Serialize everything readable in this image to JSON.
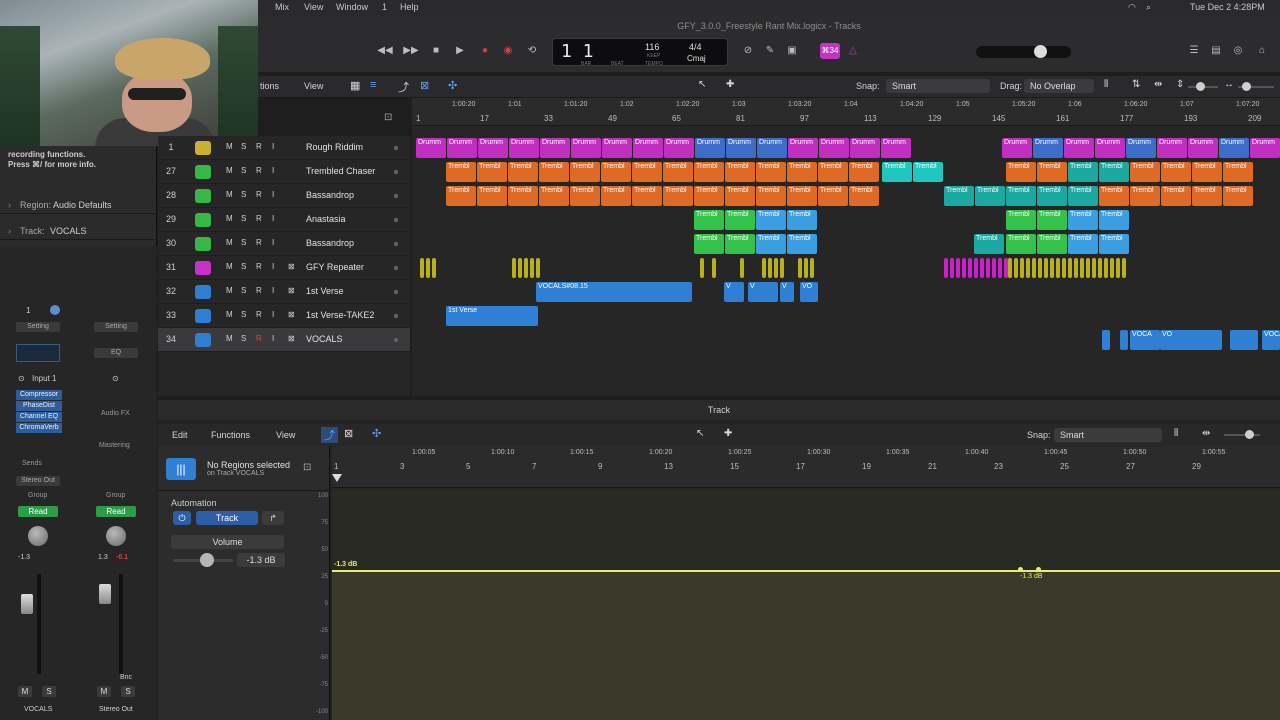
{
  "menubar": {
    "items": [
      "Mix",
      "View",
      "Window",
      "1",
      "Help"
    ],
    "datetime": "Tue Dec 2  4:28PM"
  },
  "window_title": "GFY_3.0.0_Freestyle Rant Mix.logicx - Tracks",
  "lcd": {
    "position": "1  1",
    "bpm": "116",
    "bpm_label": "KEEP",
    "signature": "4/4",
    "key": "Cmaj",
    "bar_label": "BAR",
    "beat_label": "BEAT",
    "tempo_label": "TEMPO"
  },
  "badge": "⌘34",
  "tracks_bar": {
    "functions": "tions",
    "view": "View",
    "snap_label": "Snap:",
    "snap_value": "Smart",
    "drag_label": "Drag:",
    "drag_value": "No Overlap"
  },
  "ruler": {
    "bars": [
      "1",
      "17",
      "33",
      "49",
      "65",
      "81",
      "97",
      "113",
      "129",
      "145",
      "161",
      "177",
      "193",
      "209"
    ],
    "times": [
      "1:00:20",
      "1:01",
      "1:01:20",
      "1:02",
      "1:02:20",
      "1:03",
      "1:03:20",
      "1:04",
      "1:04:20",
      "1:05",
      "1:05:20",
      "1:06",
      "1:06:20",
      "1:07",
      "1:07:20"
    ]
  },
  "tracks": [
    {
      "num": "1",
      "name": "Rough Riddim",
      "icon": "folder-icon",
      "color": "#c8b030"
    },
    {
      "num": "27",
      "name": "Trembled Chaser",
      "icon": "drummer-icon",
      "color": "#35b845"
    },
    {
      "num": "28",
      "name": "Bassandrop",
      "icon": "drummer-icon",
      "color": "#35b845"
    },
    {
      "num": "29",
      "name": "Anastasia",
      "icon": "drummer-icon",
      "color": "#35b845"
    },
    {
      "num": "30",
      "name": "Bassandrop",
      "icon": "drummer-icon",
      "color": "#35b845"
    },
    {
      "num": "31",
      "name": "GFY Repeater",
      "icon": "waveform-icon",
      "color": "#c930c9"
    },
    {
      "num": "32",
      "name": "1st Verse",
      "icon": "waveform-icon",
      "color": "#2f7fd4"
    },
    {
      "num": "33",
      "name": "1st Verse-TAKE2",
      "icon": "waveform-icon",
      "color": "#2f7fd4"
    },
    {
      "num": "34",
      "name": "VOCALS",
      "icon": "waveform-icon",
      "color": "#2f7fd4"
    }
  ],
  "track_buttons": [
    "M",
    "S",
    "R",
    "I"
  ],
  "regions": {
    "drummer": "Drumm",
    "trembl": "Trembl",
    "vocals": "VOCALS#08.15",
    "first_verse": "1st Verse",
    "v": "V",
    "vo": "VO",
    "voca": "VOCA"
  },
  "inspector": {
    "help_1": "recording functions.",
    "help_2": "Press ⌘/ for more info.",
    "region_label": "Region:",
    "region_value": "Audio Defaults",
    "track_label": "Track:",
    "track_value": "VOCALS",
    "setting": "Setting",
    "eq": "EQ",
    "input": "Input 1",
    "plugins": [
      "Compressor",
      "PhaseDist",
      "Channel EQ",
      "ChromaVerb"
    ],
    "audio_fx": "Audio FX",
    "mastering": "Mastering",
    "sends": "Sends",
    "stereo_out": "Stereo Out",
    "group": "Group",
    "read": "Read",
    "vol_left": "-1.3",
    "vol_right": "1.3",
    "vol_peak": "-6.1",
    "bnc": "Bnc",
    "channel_1_name": "VOCALS",
    "channel_2_name": "Stereo Out",
    "one": "1"
  },
  "track_panel": {
    "title": "Track",
    "edit": "Edit",
    "functions": "Functions",
    "view": "View",
    "snap_label": "Snap:",
    "snap_value": "Smart",
    "no_regions": "No Regions selected",
    "on_track": "on Track VOCALS",
    "automation": "Automation",
    "track_btn": "Track",
    "param": "Volume",
    "param_value": "-1.3 dB",
    "line_label": "-1.3 dB",
    "bars": [
      "1",
      "3",
      "5",
      "7",
      "9",
      "13",
      "15",
      "17",
      "19",
      "21",
      "23",
      "25",
      "27",
      "29"
    ],
    "times": [
      "1:00:05",
      "1:00:10",
      "1:00:15",
      "1:00:20",
      "1:00:25",
      "1:00:30",
      "1:00:35",
      "1:00:40",
      "1:00:45",
      "1:00:50",
      "1:00:55"
    ],
    "yticks": [
      "100",
      "75",
      "50",
      "25",
      "0",
      "-25",
      "-50",
      "-75",
      "-100"
    ]
  }
}
